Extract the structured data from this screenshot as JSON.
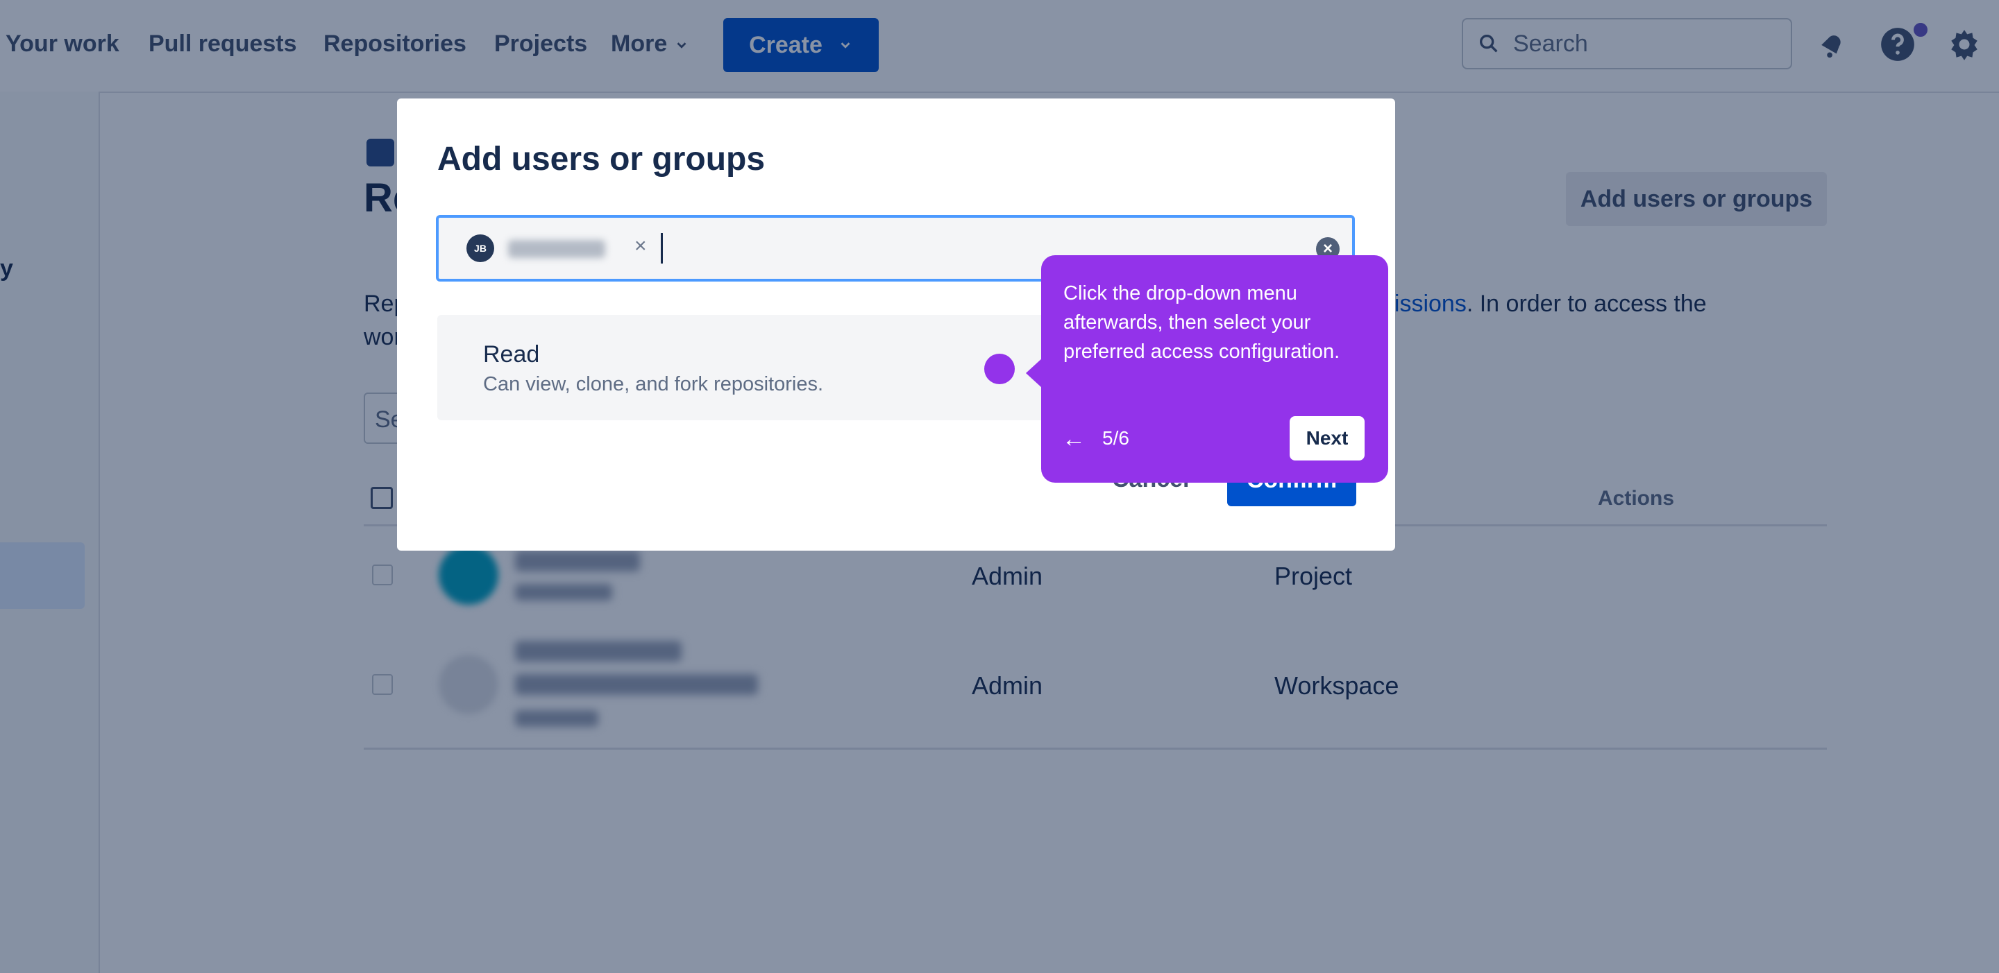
{
  "nav": {
    "items": [
      "Your work",
      "Pull requests",
      "Repositories",
      "Projects",
      "More"
    ],
    "create_label": "Create",
    "search_placeholder": "Search"
  },
  "sidebar": {
    "partial_label": "y"
  },
  "main": {
    "title_partial": "Re",
    "add_button": "Add users or groups",
    "desc_left_line1": "Rep",
    "desc_left_line2": "wor",
    "desc_link": "nissions",
    "desc_right": ". In order to access the",
    "filter_partial": "Se",
    "actions_header": "Actions",
    "rows": [
      {
        "permission": "Admin",
        "source": "Project"
      },
      {
        "permission": "Admin",
        "source": "Workspace"
      }
    ]
  },
  "modal": {
    "title": "Add users or groups",
    "chip_initials": "JB",
    "chip_remove": "×",
    "clear": "×",
    "permission_title": "Read",
    "permission_desc": "Can view, clone, and fork repositories.",
    "cancel": "Cancel",
    "confirm": "Confirm"
  },
  "tooltip": {
    "text": "Click the drop-down menu afterwards, then select your preferred access configuration.",
    "back": "←",
    "step": "5/6",
    "next": "Next"
  },
  "colors": {
    "brand": "#0052CC",
    "tooltip": "#9333EA",
    "overlay": "rgba(9,30,66,0.48)"
  }
}
